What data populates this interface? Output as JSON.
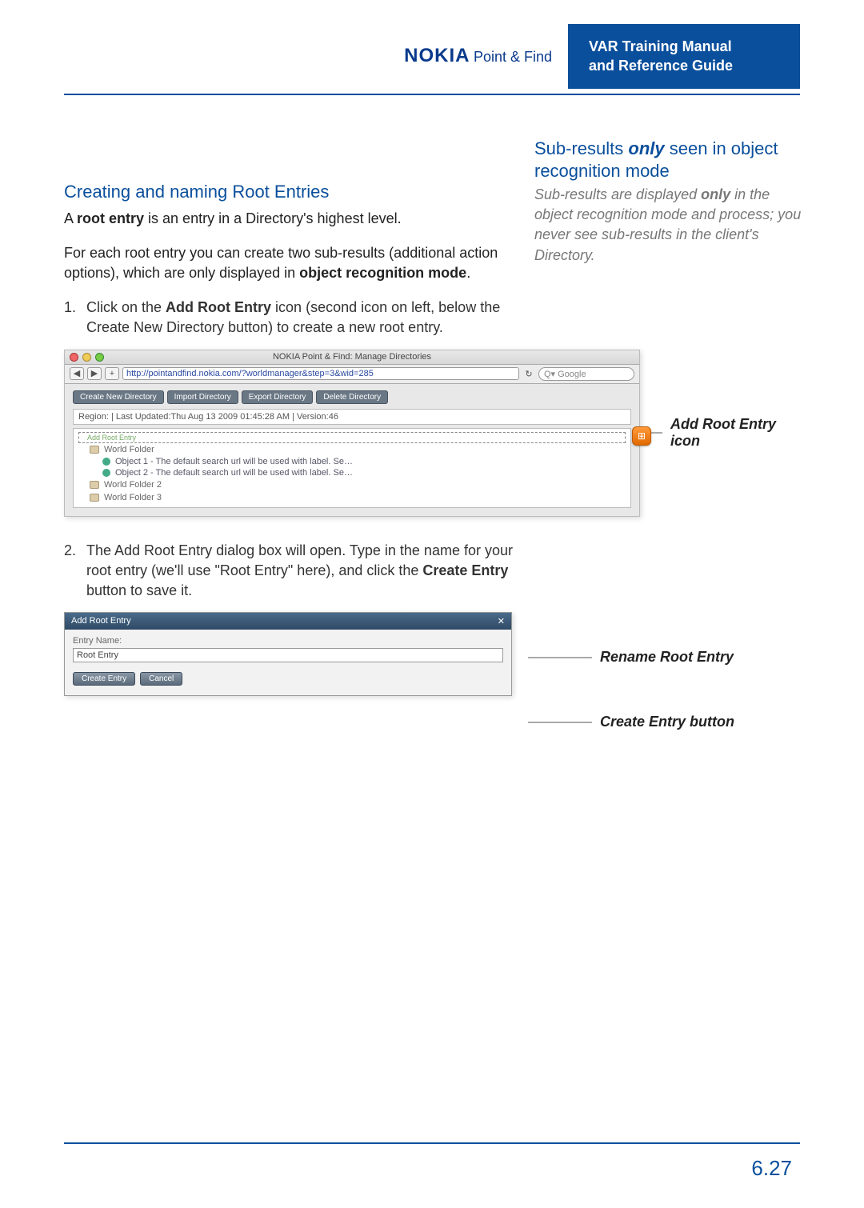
{
  "header": {
    "logo_brand": "NOKIA",
    "logo_product": "Point & Find",
    "title_line1": "VAR Training Manual",
    "title_line2": "and Reference Guide"
  },
  "sidenote": {
    "title_pre": "Sub-results ",
    "title_em": "only",
    "title_post": " seen in object recognition mode",
    "body_a": "Sub-results are displayed ",
    "body_b_bold": "only",
    "body_c": " in the object recognition mode and process; you never see sub-results in the client's Directory."
  },
  "main": {
    "section_title": "Creating and naming Root Entries",
    "para1_a": "A ",
    "para1_b_bold": "root entry",
    "para1_c": " is an entry in a Directory's highest level.",
    "para2_a": "For each root entry you can create two sub-results (additional action options), which are only displayed in ",
    "para2_b_bold": "object recognition mode",
    "para2_c": ".",
    "step1_num": "1.",
    "step1_a": "Click on the ",
    "step1_b_bold": "Add Root Entry",
    "step1_c": " icon (second icon on left, below the Create New Directory button) to create a new root entry.",
    "step2_num": "2.",
    "step2_a": "The Add Root Entry dialog box will open. Type in the name for your root entry (we'll use \"Root Entry\" here), and click the ",
    "step2_b_bold": "Create Entry",
    "step2_c": " button to save it."
  },
  "shot1": {
    "window_title": "NOKIA Point & Find: Manage Directories",
    "url": "http://pointandfind.nokia.com/?worldmanager&step=3&wid=285",
    "search_placeholder": "Q▾ Google",
    "btn_create": "Create New Directory",
    "btn_import": "Import Directory",
    "btn_export": "Export Directory",
    "btn_delete": "Delete Directory",
    "region_line": "Region: | Last Updated:Thu Aug 13 2009 01:45:28 AM | Version:46",
    "add_root_label": "Add Root Entry",
    "world_folder_sel": "World Folder",
    "obj1": "Object 1 - The default search url will be used with label. Se…",
    "obj2": "Object 2 - The default search url will be used with label. Se…",
    "wf2": "World Folder 2",
    "wf3": "World Folder 3",
    "callout": "Add Root Entry icon"
  },
  "shot2": {
    "dialog_title": "Add Root Entry",
    "label": "Entry Name:",
    "input_value": "Root Entry",
    "btn_create": "Create Entry",
    "btn_cancel": "Cancel",
    "callout_rename": "Rename Root Entry",
    "callout_create": "Create Entry button"
  },
  "footer": {
    "page_num": "6.27"
  }
}
